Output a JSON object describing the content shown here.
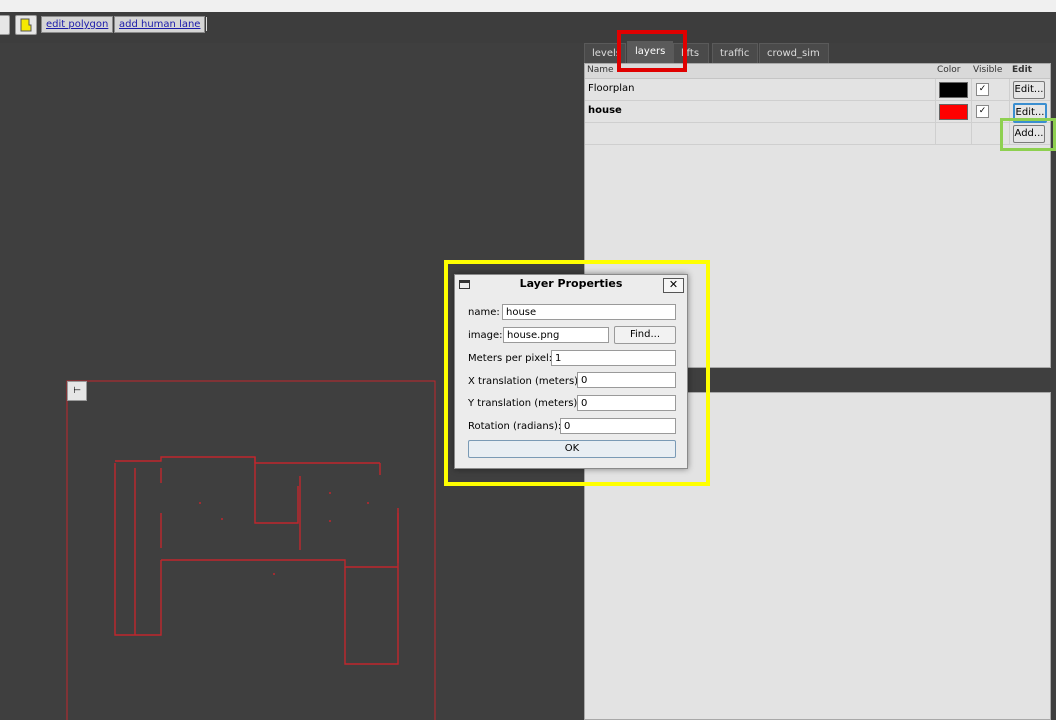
{
  "toolbar": {
    "edit_polygon_label": "edit polygon",
    "add_human_lane_label": "add human lane"
  },
  "tabs": [
    "levels",
    "layers",
    "lifts",
    "traffic",
    "crowd_sim"
  ],
  "active_tab": "layers",
  "layers_table": {
    "columns": [
      "Name",
      "Color",
      "Visible",
      "Edit"
    ],
    "rows": [
      {
        "name": "Floorplan",
        "color": "#000000",
        "visible": true,
        "edit_label": "Edit..."
      },
      {
        "name": "house",
        "color": "#ff0000",
        "visible": true,
        "edit_label": "Edit..."
      }
    ],
    "add_label": "Add..."
  },
  "dialog": {
    "title": "Layer Properties",
    "name_label": "name:",
    "name_value": "house",
    "image_label": "image:",
    "image_value": "house.png",
    "find_label": "Find...",
    "meters_per_pixel_label": "Meters per pixel:",
    "meters_per_pixel_value": "1",
    "x_translation_label": "X translation (meters):",
    "x_translation_value": "0",
    "y_translation_label": "Y translation (meters):",
    "y_translation_value": "0",
    "rotation_label": "Rotation (radians):",
    "rotation_value": "0",
    "ok_label": "OK",
    "close_glyph": "✕"
  },
  "colors": {
    "floorplan_stroke": "#c0272d",
    "highlight_tab": "#e00000",
    "highlight_add": "#8ed050",
    "highlight_dialog": "#ffff00"
  }
}
